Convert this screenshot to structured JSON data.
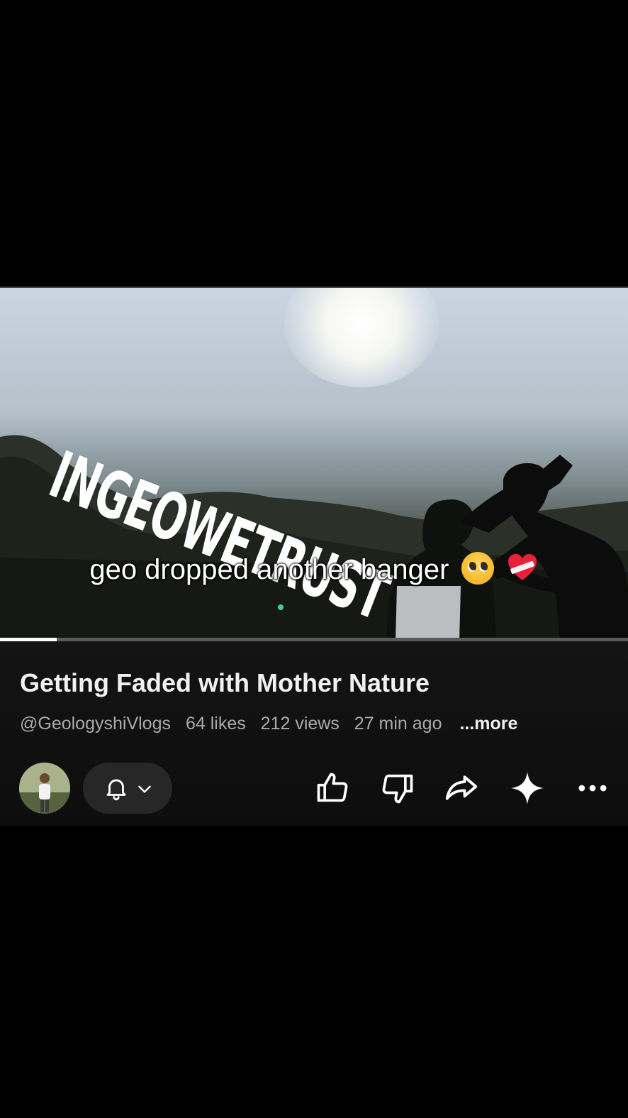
{
  "video": {
    "overlay_brand": "INGEOWETRUST",
    "caption": "geo dropped another banger",
    "caption_emojis": [
      "pleading-face-emoji",
      "mending-heart-emoji"
    ],
    "progress_fraction": 0.09
  },
  "info": {
    "title": "Getting Faded with Mother Nature",
    "channel": "@GeologyshiVlogs",
    "likes": "64 likes",
    "views": "212 views",
    "time_ago": "27 min ago",
    "more_label": "...more"
  },
  "actions": {
    "avatar_icon": "channel-avatar",
    "bell_icon": "bell-icon",
    "chevron_icon": "chevron-down-icon",
    "like_icon": "thumbs-up-icon",
    "dislike_icon": "thumbs-down-icon",
    "share_icon": "share-icon",
    "remix_icon": "sparkle-icon",
    "more_icon": "more-horizontal-icon"
  },
  "colors": {
    "background": "#000000",
    "panel": "#121212",
    "pill": "#272727",
    "meta_text": "#aaaaaa",
    "title_text": "#f1f1f1"
  }
}
